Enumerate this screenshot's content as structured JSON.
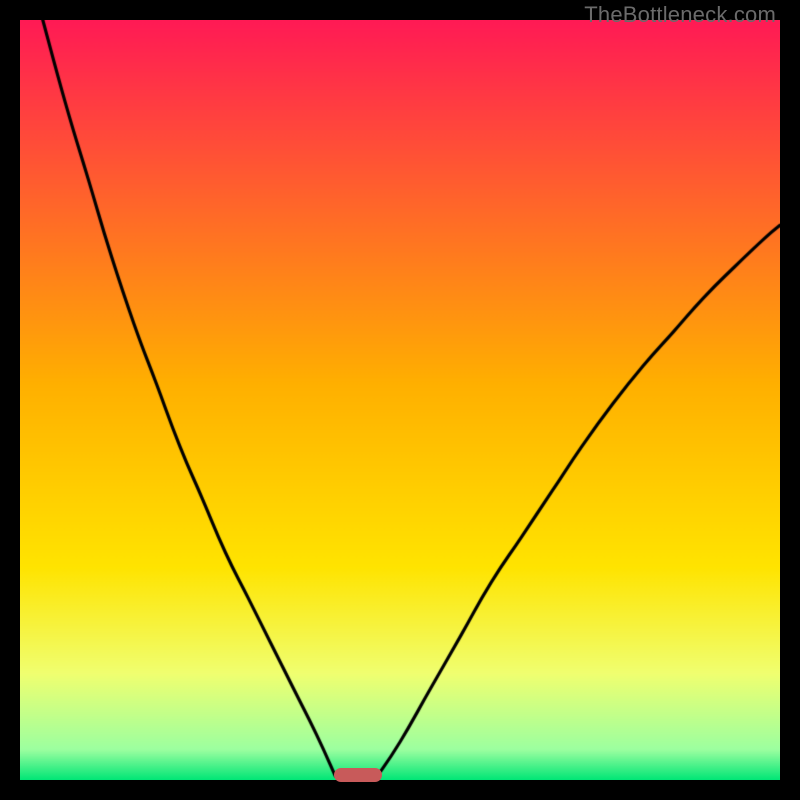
{
  "watermark": "TheBottleneck.com",
  "chart_data": {
    "type": "line",
    "title": "",
    "xlabel": "",
    "ylabel": "",
    "xlim": [
      0,
      100
    ],
    "ylim": [
      0,
      100
    ],
    "grid": false,
    "legend": false,
    "background_gradient": {
      "stops": [
        {
          "pos": 0.0,
          "color": "#ff1a55"
        },
        {
          "pos": 0.48,
          "color": "#ffb000"
        },
        {
          "pos": 0.72,
          "color": "#ffe400"
        },
        {
          "pos": 0.86,
          "color": "#f0ff70"
        },
        {
          "pos": 0.96,
          "color": "#9cffa0"
        },
        {
          "pos": 1.0,
          "color": "#00e676"
        }
      ]
    },
    "series": [
      {
        "name": "left-branch",
        "x": [
          3,
          6,
          9,
          12,
          15,
          18,
          21,
          24,
          27,
          30,
          33,
          36,
          39,
          41.5
        ],
        "y": [
          100,
          89,
          79,
          69,
          60,
          52,
          44,
          37,
          30,
          24,
          18,
          12,
          6,
          0.5
        ]
      },
      {
        "name": "right-branch",
        "x": [
          47,
          50,
          54,
          58,
          62,
          66,
          70,
          74,
          78,
          82,
          86,
          90,
          94,
          98,
          100
        ],
        "y": [
          0.5,
          5,
          12,
          19,
          26,
          32,
          38,
          44,
          49.5,
          54.5,
          59,
          63.5,
          67.5,
          71.3,
          73
        ]
      }
    ],
    "marker": {
      "x": 44.5,
      "y": 0.7,
      "color": "#c85a5a"
    }
  }
}
